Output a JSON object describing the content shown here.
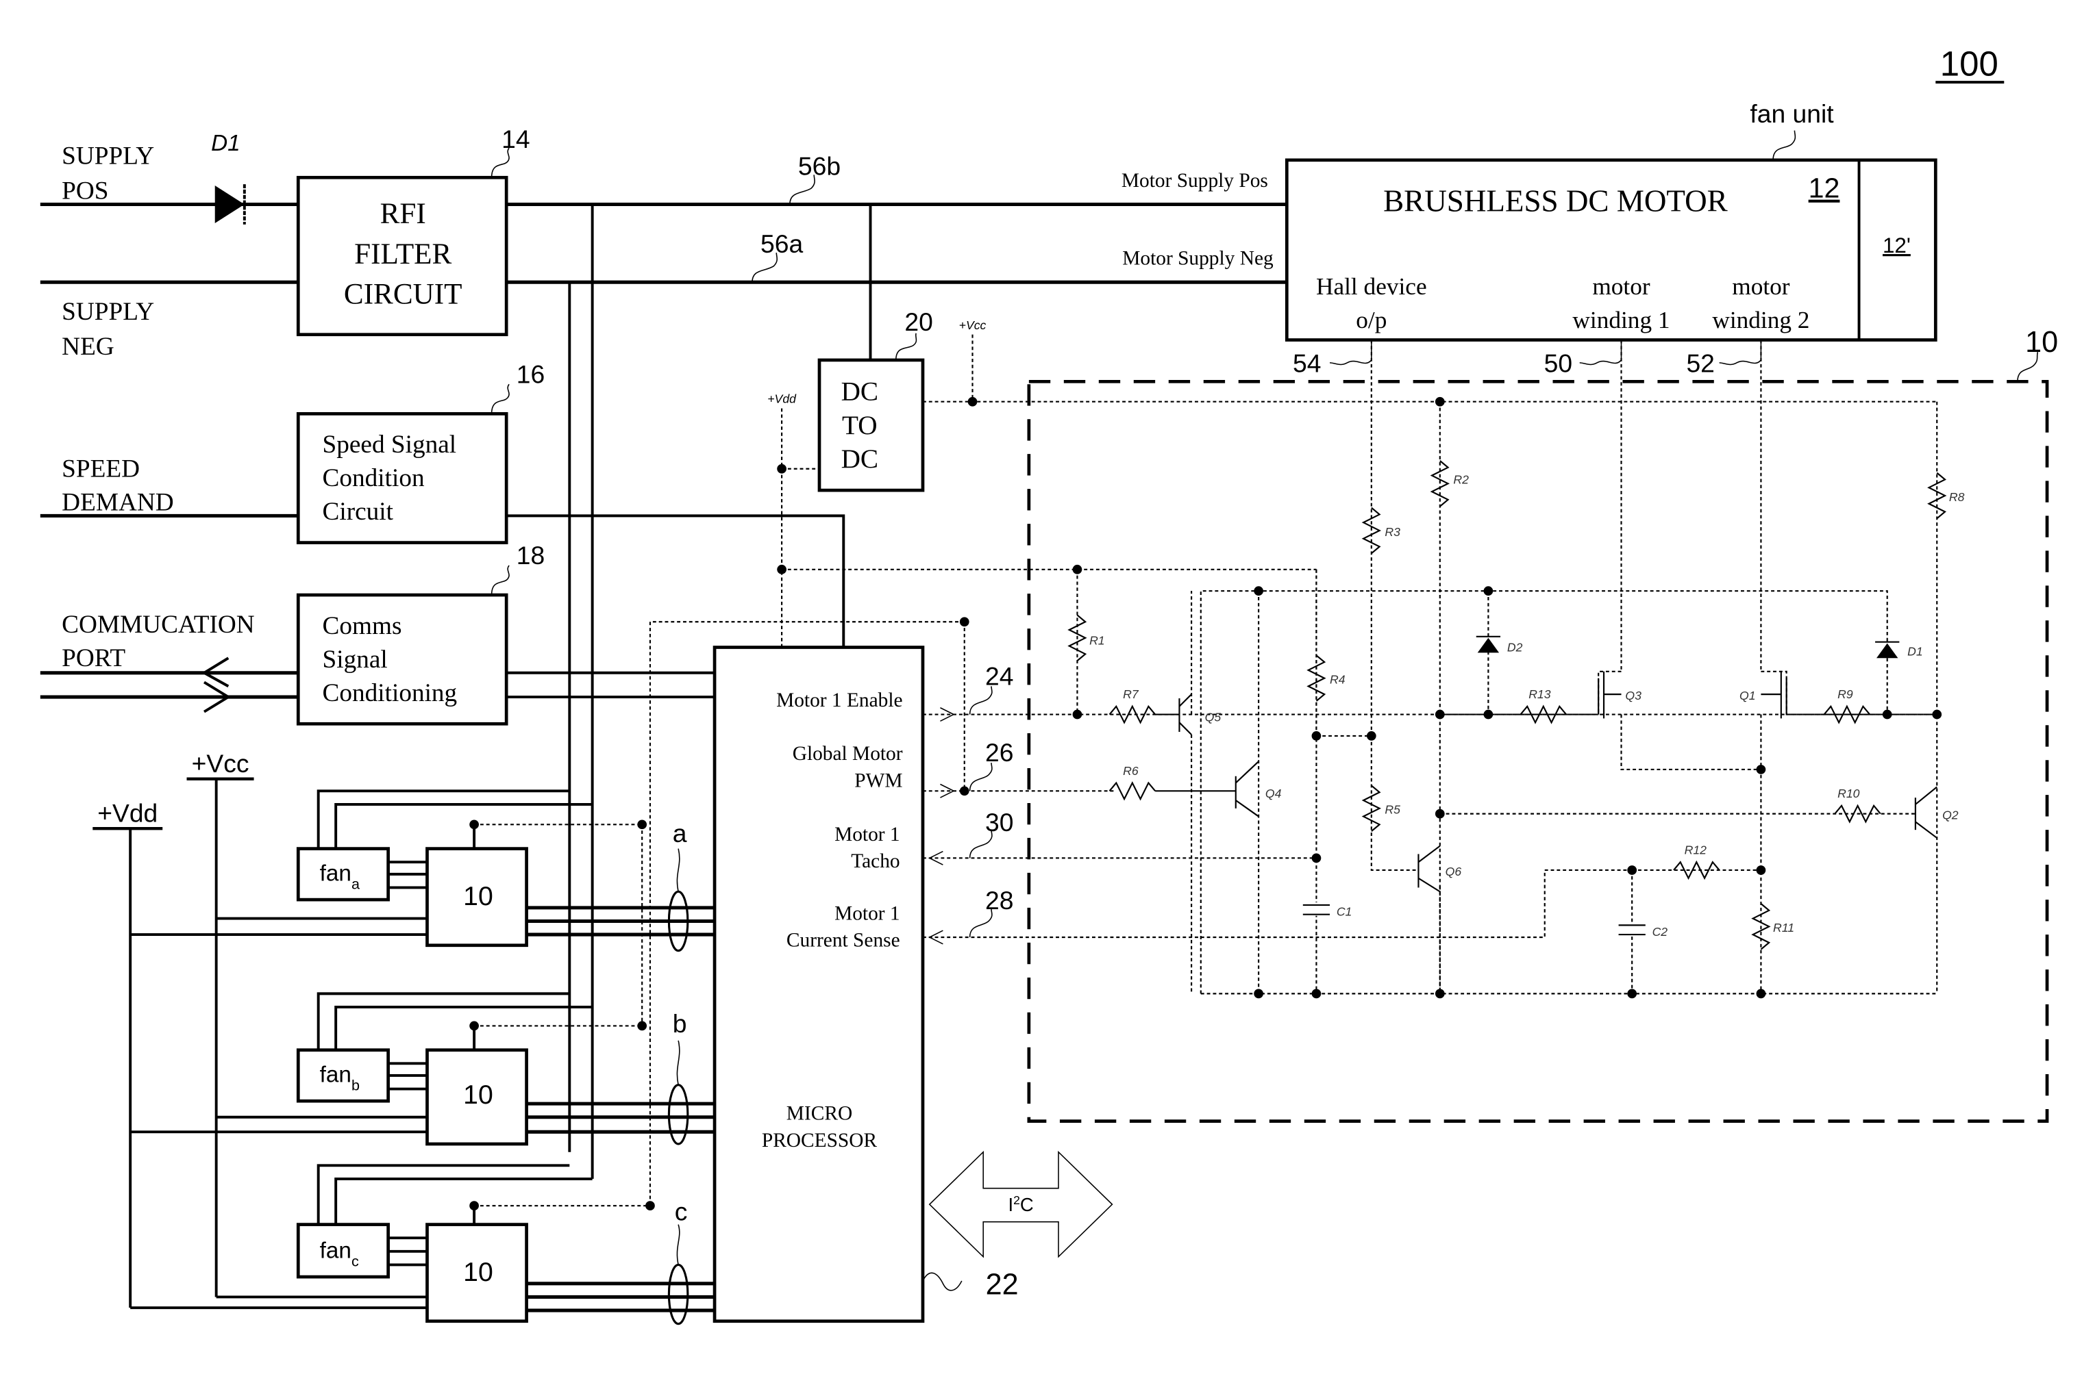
{
  "figure": {
    "reference_number": "100",
    "fan_unit_label": "fan unit"
  },
  "inputs": {
    "supply_pos": [
      "SUPPLY",
      "POS"
    ],
    "supply_neg": [
      "SUPPLY",
      "NEG"
    ],
    "speed_demand": [
      "SPEED",
      "DEMAND"
    ],
    "comm_port": [
      "COMMUCATION",
      "PORT"
    ],
    "diode_label": "D1"
  },
  "blocks": {
    "rfi_filter": {
      "lines": [
        "RFI",
        "FILTER",
        "CIRCUIT"
      ],
      "ref": "14"
    },
    "speed_signal": {
      "lines": [
        "Speed Signal",
        "Condition",
        "Circuit"
      ],
      "ref": "16"
    },
    "comms_signal": {
      "lines": [
        "Comms",
        "Signal",
        "Conditioning"
      ],
      "ref": "18"
    },
    "dc_to_dc": {
      "lines": [
        "DC",
        "TO",
        "DC"
      ],
      "ref": "20"
    },
    "microprocessor": {
      "lines": [
        "MICRO",
        "PROCESSOR"
      ],
      "ref": "22",
      "pins": [
        {
          "lines": [
            "Motor 1 Enable"
          ],
          "ref": "24",
          "direction": "out"
        },
        {
          "lines": [
            "Global Motor",
            "PWM"
          ],
          "ref": "26",
          "direction": "out"
        },
        {
          "lines": [
            "Motor 1",
            "Tacho"
          ],
          "ref": "30",
          "direction": "in"
        },
        {
          "lines": [
            "Motor 1",
            "Current Sense"
          ],
          "ref": "28",
          "direction": "in"
        }
      ]
    },
    "motor": {
      "title": "BRUSHLESS DC MOTOR",
      "ref": "12",
      "ref_prime": "12'",
      "supply_pos_label": "Motor Supply Pos",
      "supply_neg_label": "Motor Supply Neg",
      "outputs": [
        {
          "lines": [
            "Hall device",
            "o/p"
          ],
          "ref": "54"
        },
        {
          "lines": [
            "motor",
            "winding 1"
          ],
          "ref": "50"
        },
        {
          "lines": [
            "motor",
            "winding 2"
          ],
          "ref": "52"
        }
      ]
    },
    "control_circuit": {
      "ref": "10"
    },
    "i2c": {
      "label": "I",
      "sup": "2",
      "suffix": "C"
    }
  },
  "buses": {
    "pos_ref": "56b",
    "neg_ref": "56a"
  },
  "rails": {
    "vcc": "+Vcc",
    "vdd": "+Vdd",
    "vcc_small": "+Vcc",
    "vdd_small": "+Vdd"
  },
  "fans": [
    {
      "name": "fan",
      "sub": "a",
      "controller": "10",
      "bus_label": "a"
    },
    {
      "name": "fan",
      "sub": "b",
      "controller": "10",
      "bus_label": "b"
    },
    {
      "name": "fan",
      "sub": "c",
      "controller": "10",
      "bus_label": "c"
    }
  ],
  "components": {
    "resistors": [
      "R1",
      "R2",
      "R3",
      "R4",
      "R5",
      "R6",
      "R7",
      "R8",
      "R9",
      "R10",
      "R11",
      "R12",
      "R13"
    ],
    "transistors": [
      "Q1",
      "Q2",
      "Q3",
      "Q4",
      "Q5",
      "Q6"
    ],
    "diodes": [
      "D1",
      "D2"
    ],
    "capacitors": [
      "C1",
      "C2"
    ]
  }
}
